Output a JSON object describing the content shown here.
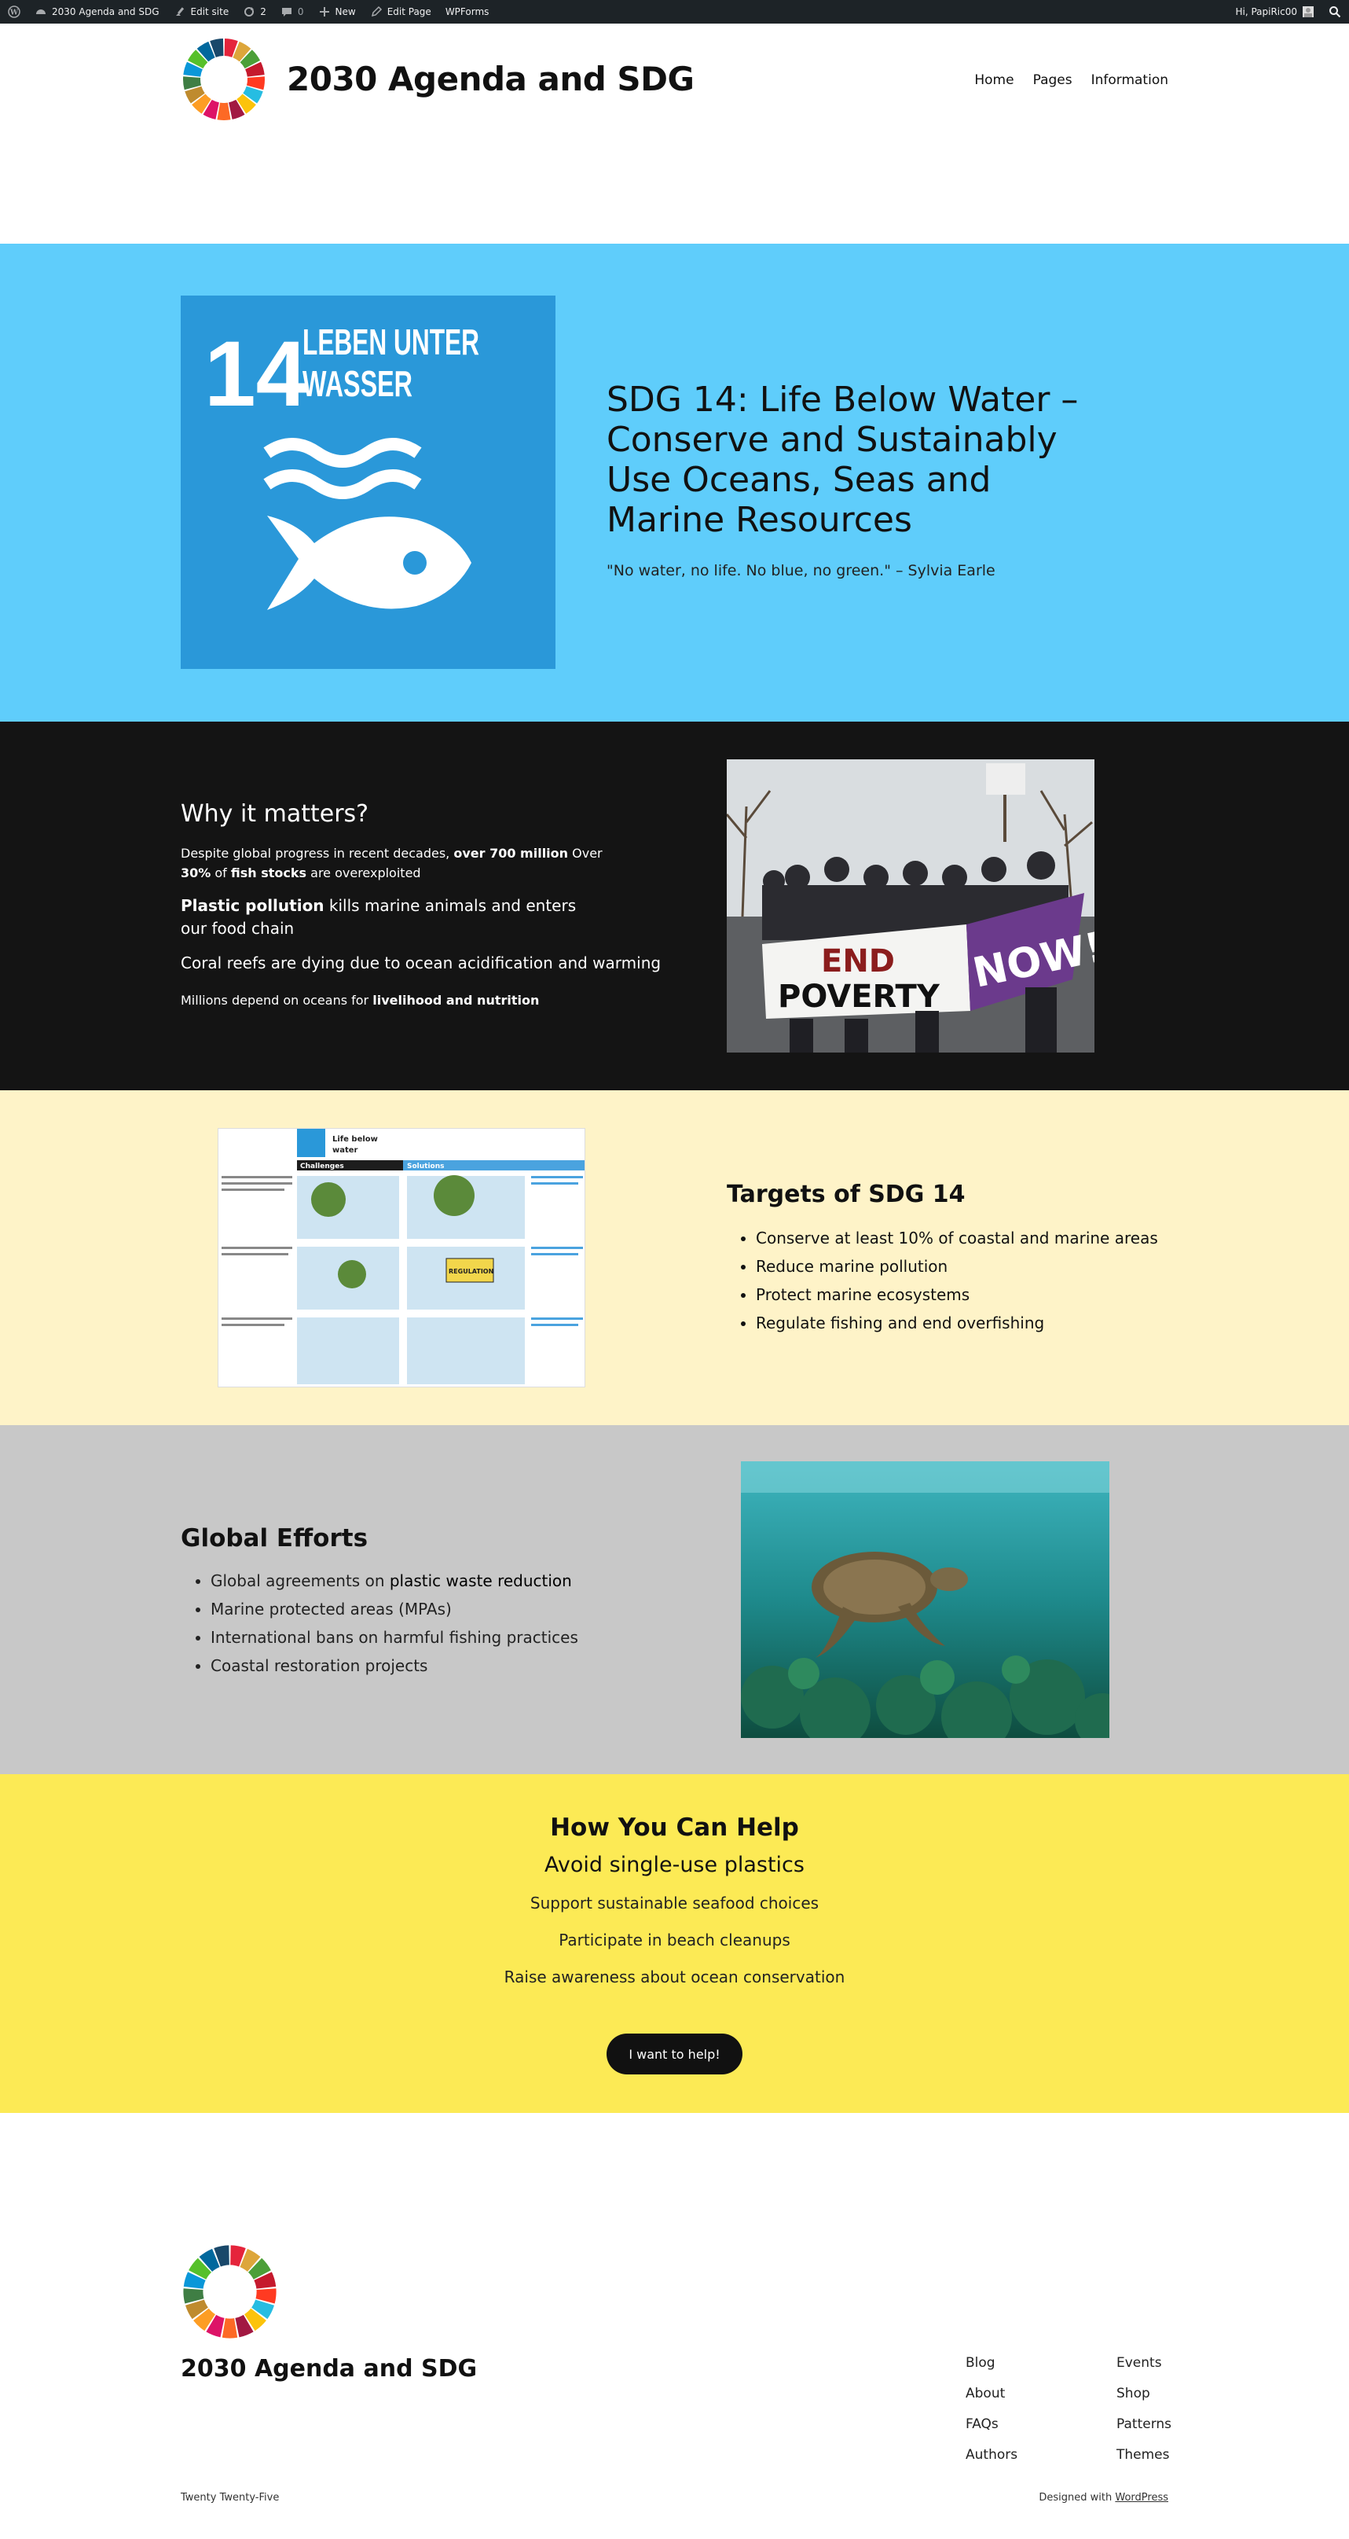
{
  "adminbar": {
    "site_name": "2030 Agenda and SDG",
    "edit_site": "Edit site",
    "updates_count": "2",
    "comments_count": "0",
    "new_label": "New",
    "edit_page": "Edit Page",
    "wpforms": "WPForms",
    "greeting": "Hi, PapiRic00",
    "icons": [
      "wordpress-icon",
      "dashboard-icon",
      "brush-icon",
      "updates-icon",
      "comment-icon",
      "plus-icon",
      "pencil-icon",
      "search-icon"
    ]
  },
  "header": {
    "site_title": "2030 Agenda and SDG",
    "nav": [
      "Home",
      "Pages",
      "Information"
    ]
  },
  "hero": {
    "tile_number": "14",
    "tile_text_line1": "LEBEN UNTER",
    "tile_text_line2": "WASSER",
    "tile_color": "#2a98d9",
    "background": "#5fcdfb",
    "title": "SDG 14: Life Below Water – Conserve and Sustainably Use Oceans, Seas and Marine Resources",
    "quote": "\"No water, no life. No blue, no green.\" – Sylvia Earle"
  },
  "why": {
    "heading": "Why it matters?",
    "p1_a": "Despite global progress in recent decades, ",
    "p1_b": "over 700 million",
    "p1_c": " Over ",
    "p1_d": "30%",
    "p1_e": " of ",
    "p1_f": "fish stocks",
    "p1_g": " are overexploited",
    "p2_a": "Plastic pollution",
    "p2_b": " kills marine animals and enters our food chain",
    "p3": "Coral reefs are dying due to ocean acidification and warming",
    "p4_a": "Millions depend on oceans for ",
    "p4_b": "livelihood and nutrition",
    "photo_banner_line1": "END",
    "photo_banner_line2": "POVERTY",
    "photo_banner_now": "NOW!"
  },
  "targets": {
    "heading": "Targets of SDG 14",
    "items": [
      "Conserve at least 10% of coastal and marine areas",
      "Reduce marine pollution",
      "Protect marine ecosystems",
      "Regulate fishing and end overfishing"
    ],
    "infographic": {
      "title_line1": "Life below",
      "title_line2": "water",
      "challenges": "Challenges",
      "solutions": "Solutions",
      "sign": "REGULATION"
    }
  },
  "efforts": {
    "heading": "Global Efforts",
    "item1_a": "Global agreements on ",
    "item1_b": "plastic waste reduction",
    "items": [
      "Marine protected areas (MPAs)",
      "International bans on harmful fishing practices",
      "Coastal restoration projects"
    ]
  },
  "help": {
    "heading": "How You Can Help",
    "subheading": "Avoid single-use plastics",
    "lines": [
      "Support sustainable seafood choices",
      "Participate in beach cleanups",
      "Raise awareness about ocean conservation"
    ],
    "button": "I want to help!"
  },
  "footer": {
    "title": "2030 Agenda and SDG",
    "col1": [
      "Blog",
      "About",
      "FAQs",
      "Authors"
    ],
    "col2": [
      "Events",
      "Shop",
      "Patterns",
      "Themes"
    ],
    "theme_name": "Twenty Twenty-Five",
    "designed_with": "Designed with ",
    "wordpress": "WordPress"
  }
}
